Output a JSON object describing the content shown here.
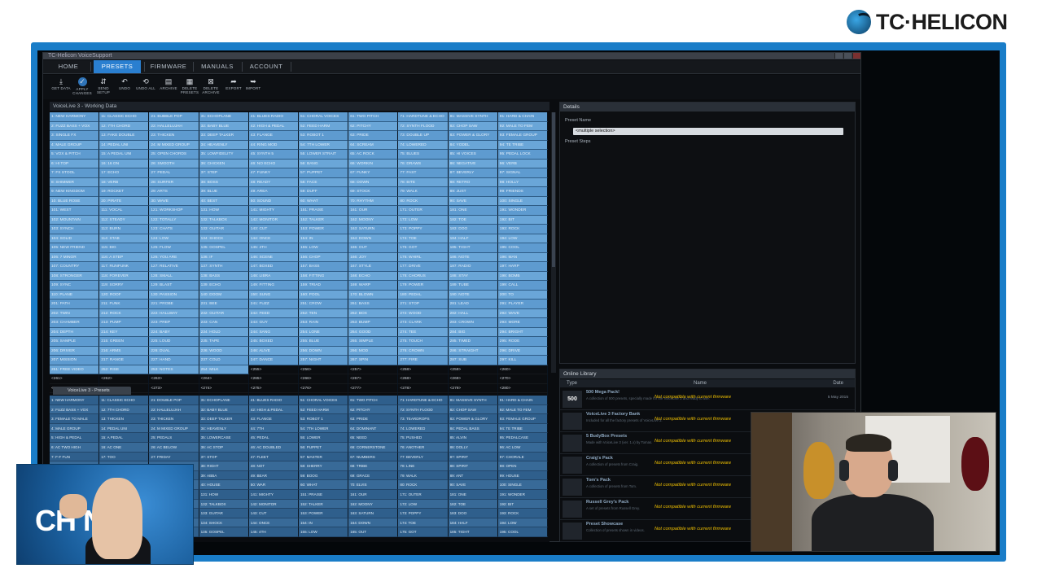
{
  "brand": {
    "text": "TC·HELICON"
  },
  "app": {
    "title": "TC-Helicon VoiceSupport",
    "nav": [
      "HOME",
      "PRESETS",
      "FIRMWARE",
      "MANUALS",
      "ACCOUNT"
    ],
    "active_nav": "PRESETS",
    "toolbar": [
      {
        "icon": "get-icon",
        "label": "GET\nDATA"
      },
      {
        "icon": "apply-icon",
        "label": "APPLY\nCHANGES"
      },
      {
        "icon": "send-icon",
        "label": "SEND\nSETUP"
      },
      {
        "icon": "undo-icon",
        "label": "UNDO"
      },
      {
        "icon": "undo-all-icon",
        "label": "UNDO\nALL"
      },
      {
        "icon": "archive-icon",
        "label": "ARCHIVE"
      },
      {
        "icon": "delete-presets-icon",
        "label": "DELETE\nPRESETS"
      },
      {
        "icon": "delete-archive-icon",
        "label": "DELETE\nARCHIVE"
      },
      {
        "icon": "export-icon",
        "label": "EXPORT"
      },
      {
        "icon": "import-icon",
        "label": "IMPORT"
      }
    ]
  },
  "working_data": {
    "title": "VoiceLive 3 - Working Data",
    "cells": [
      "1: NEW HARMONY",
      "11: CLASSIC ECHO",
      "21: BUBBLE POP",
      "31: ECHOPLANE",
      "41: BLUES RADIO",
      "51: CHORAL VOICES",
      "61: TWO PITCH",
      "71: HARDTUNE & ECHO",
      "81: MASSIVE SYNTH",
      "91: HARD & CHAIN",
      "2: FUZZ BASS + VOX",
      "12: 7TH CHORD",
      "22: HALLELUJAH",
      "32: BABY BLUE",
      "42: HIGH & PEDAL",
      "52: FEED HARM",
      "62: PITCHY",
      "72: SYNTH FLOOD",
      "82: CHOP SAW",
      "92: MALE TO FEM",
      "3: SINGLE FX",
      "13: FAKE DOUBLE",
      "23: THICKEN",
      "33: DEEP TALKER",
      "43: FLANGE",
      "53: ROBOT 1",
      "63: PRIDE",
      "73: DOUBLE UP",
      "83: POWER & GLORY",
      "93: FEMALE GROUP",
      "4: MALE GROUP",
      "14: PEDAL UNI",
      "24: M MIXED GROUP",
      "34: HEAVENLY",
      "44: RING MOD",
      "54: 7TH LOWER",
      "64: SCREAM",
      "74: LOWERED",
      "84: YODEL",
      "94: TE TRIBE",
      "5: VOX & PITCH",
      "15: A PEDAL UNI",
      "25: OPEN CHORDS",
      "35: LOWFIDELITY",
      "45: SYNTH 5",
      "55: LOWER STRAIT",
      "65: AC ROCK",
      "75: BLUES",
      "85: HI VOICES",
      "95: PEDAL LOCK",
      "6: HI TOP",
      "16: 16 ON",
      "26: SMOOTH",
      "36: CHICKEN",
      "46: NO ECHO",
      "56: BANG",
      "66: WORKIN",
      "76: DRAWS",
      "86: NEGATIVE",
      "96: VERB",
      "7: FX STOOL",
      "17: ECHO",
      "27: PEDAL",
      "37: STEP",
      "47: FUNKY",
      "57: PUPPET",
      "67: FUNKY",
      "77: FAST",
      "87: BEVERLY",
      "97: SIGNAL",
      "8: SHIMMER",
      "18: VERB",
      "28: SURFER",
      "38: BOSS",
      "48: READY",
      "58: FACE",
      "68: DOWN",
      "78: BITE",
      "88: RETRO",
      "98: HOLLY",
      "9: NEW KINGDOM",
      "19: ROCKET",
      "29: ARTS",
      "39: BLUE",
      "49: AREA",
      "59: DUFF",
      "69: STOCK",
      "79: WALK",
      "89: JUST",
      "99: FRIENDS",
      "10: BLUE ROSE",
      "20: PIRATE",
      "30: WAVE",
      "40: BEST",
      "50: SOUND",
      "60: WHAT",
      "70: RHYTHM",
      "80: ROCK",
      "90: SAVE",
      "100: SINGLE",
      "101: WEST",
      "111: VOCAL",
      "121: WORKSHOP",
      "131: HOW",
      "141: MIGHTY",
      "151: PRAISE",
      "161: OUR",
      "171: OUTER",
      "181: ONE",
      "191: WONDER",
      "102: MOUNTAIN",
      "112: STEADY",
      "122: TOTALLY",
      "132: TALKBOX",
      "142: MONITOR",
      "152: TALKER",
      "162: MOONY",
      "172: LOW",
      "182: TOE",
      "192: BIT",
      "103: SYNCH",
      "113: BURN",
      "123: CHATS",
      "133: GUITAR",
      "143: CUT",
      "153: POWER",
      "163: SATURN",
      "173: POPPY",
      "183: DOO",
      "193: ROCK",
      "104: SOLID",
      "114: STAB",
      "124: LOW",
      "134: SHOCK",
      "144: ONCE",
      "154: IN",
      "164: DOWN",
      "174: TOE",
      "184: HALF",
      "194: LOW",
      "105: NEW FRIEND",
      "115: BIG",
      "125: FLOW",
      "135: GOSPEL",
      "145: 4TH",
      "155: LOW",
      "165: OUT",
      "175: GOT",
      "185: TIGHT",
      "195: COOL",
      "106: 7 MINOR",
      "116: A STEP",
      "126: YOU ARE",
      "136: IF",
      "146: SCENE",
      "156: CHOP",
      "166: JOY",
      "176: WHIRL",
      "186: NOTE",
      "196: MAN",
      "107: COUNTRY",
      "117: RUNFUNK",
      "127: RELATIVE",
      "137: SYNTH",
      "147: BOXED",
      "157: BASS",
      "167: STYLE",
      "177: DRIVE",
      "187: RADIO",
      "197: HARP",
      "108: STRONGER",
      "118: FOREVER",
      "128: SMALL",
      "138: BASS",
      "148: LIBRA",
      "158: FITTING",
      "168: ECHO",
      "178: CHORUS",
      "188: STAY",
      "198: BOMB",
      "109: SYNC",
      "119: SORRY",
      "129: BLAST",
      "139: ECHO",
      "149: FITTING",
      "159: TRIAD",
      "169: WARP",
      "179: POWER",
      "189: TUBE",
      "199: CALL",
      "110: PLANE",
      "120: ROOF",
      "130: PASSION",
      "140: DOOM",
      "150: SUNG",
      "160: POOL",
      "170: BLOWN",
      "180: PEDAL",
      "190: NOTE",
      "200: TO",
      "201: PATH",
      "211: FUNK",
      "221: PROBE",
      "231: BEE",
      "241: FUZZ",
      "251: CROW",
      "261: BASS",
      "271: STOP",
      "281: LEAD",
      "291: PLAYER",
      "202: TWIN",
      "212: ROCK",
      "222: HALLWAY",
      "232: GUITAR",
      "242: FEED",
      "252: TEN",
      "262: BOX",
      "272: WOOD",
      "282: HALL",
      "292: WAVE",
      "203: CHAMBER",
      "213: PUMP",
      "223: PREP",
      "233: CAN",
      "243: GUY",
      "253: RAIN",
      "263: BUMP",
      "273: CLARK",
      "283: CROWN",
      "293: MORE",
      "204: DEPTH",
      "214: KEY",
      "224: BABY",
      "234: HOLD",
      "244: SANG",
      "254: LONE",
      "264: GOOD",
      "274: TEE",
      "284: BIG",
      "294: BRIGHT",
      "205: SAMPLE",
      "215: GREEN",
      "225: LOUD",
      "235: TAPE",
      "245: BOXED",
      "255: BLUE",
      "265: SIMPLE",
      "275: TOUCH",
      "285: TIMED",
      "295: RODE",
      "206: DRIVER",
      "216: ARMS",
      "226: DUAL",
      "236: WOOD",
      "246: ALIVE",
      "256: DOWN",
      "266: MOD",
      "276: CROWN",
      "286: STRAIGHT",
      "296: DRIVE",
      "207: MISSION",
      "217: RANGE",
      "227: HAND",
      "237: COLD",
      "247: DANCE",
      "257: NIGHT",
      "267: SPIN",
      "277: FIRE",
      "287: SUB",
      "297: KILL",
      "251: FREE VIDEO",
      "252: RISE",
      "253: NOTES",
      "254: MILK",
      "<255>",
      "<256>",
      "<257>",
      "<258>",
      "<259>",
      "<260>",
      "<261>",
      "<262>",
      "<263>",
      "<264>",
      "<265>",
      "<266>",
      "<267>",
      "<268>",
      "<269>",
      "<270>",
      "<271>",
      "<272>",
      "<273>",
      "<274>",
      "<275>",
      "<276>",
      "<277>",
      "<278>",
      "<279>",
      "<280>",
      "<281>",
      "<282>",
      "<283>",
      "<284>",
      "<285>",
      "<286>",
      "<287>",
      "<288>",
      "<289>",
      "<290>"
    ]
  },
  "preset_panel": {
    "tab": "VoiceLive 3 - Presets",
    "cells": [
      "1: NEW HARMONY",
      "11: CLASSIC ECHO",
      "21: DOUBLE POP",
      "31: ECHOPLANE",
      "41: BLUES RADIO",
      "51: CHORAL VOICES",
      "61: TWO PITCH",
      "71: HARDTUNE & ECHO",
      "81: MASSIVE SYNTH",
      "91: HARD & CHAIN",
      "2: FUZZ BASS + VOX",
      "12: 7TH CHORD",
      "22: HALLELUJAH",
      "32: BABY BLUE",
      "42: HIGH & PEDAL",
      "52: FEED HARM",
      "62: PITCHY",
      "72: SYNTH FLOOD",
      "82: CHOP SAW",
      "92: MALE TO FEM",
      "3: FEMALE TO MALE",
      "13: THICKEN",
      "23: THICKEN",
      "33: DEEP TALKER",
      "43: FLANGE",
      "53: ROBOT 1",
      "63: PRIDE",
      "73: TEARDROPS",
      "83: POWER & GLORY",
      "93: FEMALE GROUP",
      "4: MALE GROUP",
      "14: PEDAL UNI",
      "24: M MIXED GROUP",
      "34: HEAVENLY",
      "44: 7TH",
      "54: 7TH LOWER",
      "64: DOMINANT",
      "74: LOWERED",
      "84: PEDAL BASS",
      "94: TE TRIBE",
      "5: HIGH & PEDAL",
      "15: A PEDAL",
      "25: PEDALS",
      "35: LOWERCASE",
      "45: PEDAL",
      "55: LOWER",
      "65: NEED",
      "75: PUSHED",
      "85: ALVIN",
      "95: PEDALCASE",
      "6: AC TWO HIGH",
      "16: AC ONE",
      "26: AC BELOW",
      "36: AC STOP",
      "46: AC DOUBLED",
      "56: PUPPET",
      "66: CORNERSTONE",
      "76: ANOTHER",
      "86: DOLLY",
      "96: AC LOW",
      "7: F-F FUN",
      "17: TOO",
      "27: FRIDAY",
      "37: STOP",
      "47: FLEET",
      "57: MASTER",
      "67: NUMBERS",
      "77: BEVERLY",
      "87: SPIRIT",
      "97: CHORALE",
      "8: DOUBLE",
      "18: TAPE",
      "28: BARS",
      "38: RIGHT",
      "48: NOT",
      "58: SHERRY",
      "68: TRIBE",
      "78: LINE",
      "88: SPIRIT",
      "98: OPEN",
      "9: SINGLE",
      "19: RIDE",
      "29: SINGLE",
      "39: ABBA",
      "49: BEAR",
      "59: BOOG",
      "69: GRACE",
      "79: WALK",
      "89: ANT",
      "99: HOUSE",
      "10: KING",
      "20: STOP",
      "30: DIRT",
      "40: HOUSE",
      "50: WAR",
      "60: WHAT",
      "70: ELVIS",
      "80: ROCK",
      "90: SAVE",
      "100: SINGLE",
      "101: WEST",
      "111: VOCAL",
      "121: WORKSHOP",
      "131: HOW",
      "141: MIGHTY",
      "151: PRAISE",
      "161: OUR",
      "171: OUTER",
      "181: ONE",
      "191: WONDER",
      "102: MOUNTAIN",
      "112: STEADY",
      "122: TOTALLY",
      "132: TALKBOX",
      "142: MONITOR",
      "152: TALKER",
      "162: MOONY",
      "172: LOW",
      "182: TOE",
      "192: BIT",
      "103: SYNCH",
      "113: BURN",
      "123: CHATS",
      "133: GUITAR",
      "143: CUT",
      "153: POWER",
      "163: SATURN",
      "173: POPPY",
      "183: DOO",
      "193: ROCK",
      "104: SOLID",
      "114: STAB",
      "124: LOW",
      "134: SHOCK",
      "144: ONCE",
      "154: IN",
      "164: DOWN",
      "174: TOE",
      "184: HALF",
      "194: LOW",
      "105: NEW FRIEND",
      "115: BIG",
      "125: FLOW",
      "135: GOSPEL",
      "145: 4TH",
      "155: LOW",
      "165: OUT",
      "175: GOT",
      "185: TIGHT",
      "195: COOL"
    ]
  },
  "details": {
    "title": "Details",
    "preset_name_label": "Preset Name",
    "preset_name_value": "<multiple selection>",
    "preset_steps_label": "Preset Steps"
  },
  "online_library": {
    "title": "Online Library",
    "columns": [
      "Type",
      "Name",
      "Date"
    ],
    "rows": [
      {
        "thumb": "500",
        "name": "500 Mega Pack!",
        "desc": "A collection of 500 presets, specially made for the VoiceLive 3 and ready to use.",
        "warning": "Not compatible with current firmware",
        "date": "5 May 2015"
      },
      {
        "thumb": "",
        "name": "VoiceLive 3 Factory Bank",
        "desc": "Included for all the factory presets of VoiceLive 3.",
        "warning": "Not compatible with current firmware",
        "date": ""
      },
      {
        "thumb": "",
        "name": "5 BudyBox Presets",
        "desc": "Made with VoiceLive 3 (ver. 1.x) by Tomas.",
        "warning": "Not compatible with current firmware",
        "date": ""
      },
      {
        "thumb": "",
        "name": "Craig's Pack",
        "desc": "A collection of presets from Craig.",
        "warning": "Not compatible with current firmware",
        "date": ""
      },
      {
        "thumb": "",
        "name": "Tom's Pack",
        "desc": "A collection of presets from Tom.",
        "warning": "Not compatible with current firmware",
        "date": ""
      },
      {
        "thumb": "",
        "name": "Russell Grey's Pack",
        "desc": "A set of presets from Russell Grey.",
        "warning": "Not compatible with current firmware",
        "date": ""
      },
      {
        "thumb": "",
        "name": "Preset Showcase",
        "desc": "Collection of presets shown in videos.",
        "warning": "Not compatible with current firmware",
        "date": ""
      }
    ]
  },
  "overlay": {
    "channel_word": "CH     NER"
  }
}
